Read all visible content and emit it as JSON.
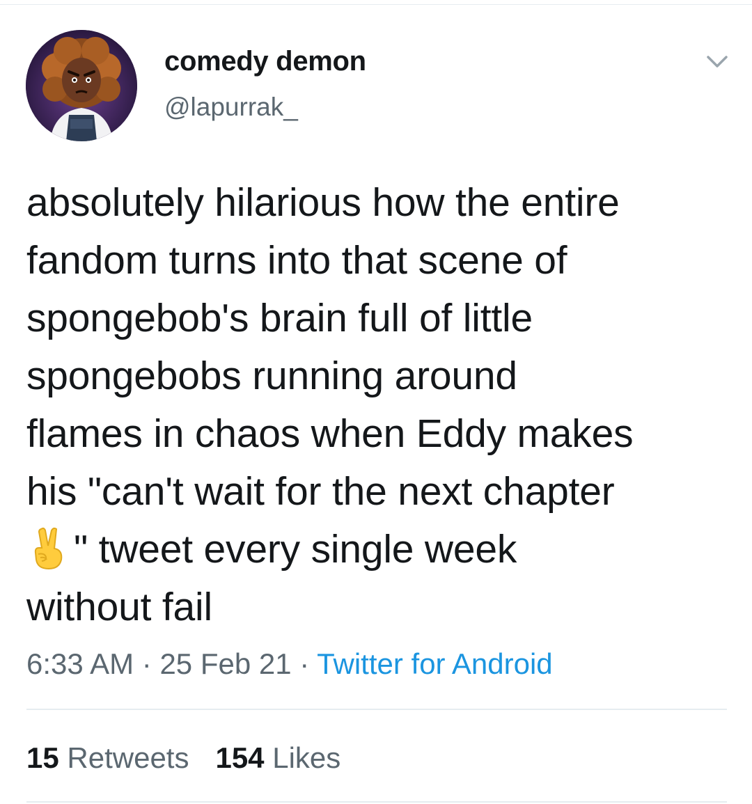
{
  "author": {
    "display_name": "comedy demon",
    "handle": "@lapurrak_"
  },
  "tweet": {
    "text_before_emoji": "absolutely hilarious how the entire\nfandom turns into that scene of\nspongebob's brain full of little\nspongebobs running around\nflames in chaos when Eddy makes\nhis \"can't wait for the next chapter\n",
    "emoji": "victory-hand-emoji",
    "text_after_emoji": "\" tweet every single week\nwithout fail"
  },
  "meta": {
    "time": "6:33 AM",
    "sep1": " · ",
    "date": "25 Feb 21",
    "sep2": " · ",
    "source": "Twitter for Android"
  },
  "stats": {
    "retweets_count": "15",
    "retweets_label": "Retweets",
    "likes_count": "154",
    "likes_label": "Likes"
  },
  "colors": {
    "text": "#14171a",
    "secondary": "#5b6770",
    "link": "#1b95e0",
    "divider": "#e6ecf0"
  }
}
